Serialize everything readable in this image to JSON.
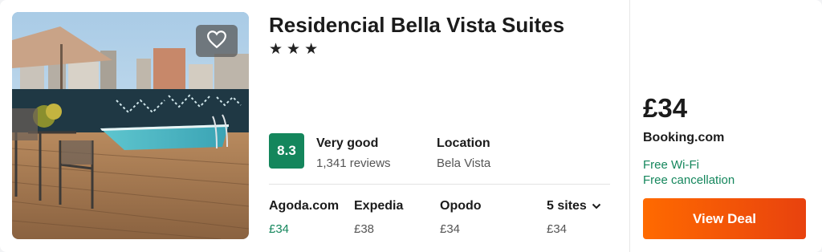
{
  "hotel": {
    "name": "Residencial Bella Vista Suites",
    "stars": "★★★",
    "rating": {
      "score": "8.3",
      "label": "Very good",
      "reviews": "1,341 reviews"
    },
    "location": {
      "label": "Location",
      "value": "Bela Vista"
    }
  },
  "sites": [
    {
      "name": "Agoda.com",
      "price": "£34"
    },
    {
      "name": "Expedia",
      "price": "£38"
    },
    {
      "name": "Opodo",
      "price": "£34"
    },
    {
      "name": "5 sites",
      "price": "£34"
    }
  ],
  "deal": {
    "price": "£34",
    "provider": "Booking.com",
    "perks": [
      "Free Wi-Fi",
      "Free cancellation"
    ],
    "button_label": "View Deal"
  },
  "icons": {
    "favorite": "heart-icon",
    "expand": "chevron-down-icon"
  },
  "colors": {
    "score_badge": "#14865c",
    "perk_text": "#14865c",
    "deal_button": "#f05a0a"
  }
}
